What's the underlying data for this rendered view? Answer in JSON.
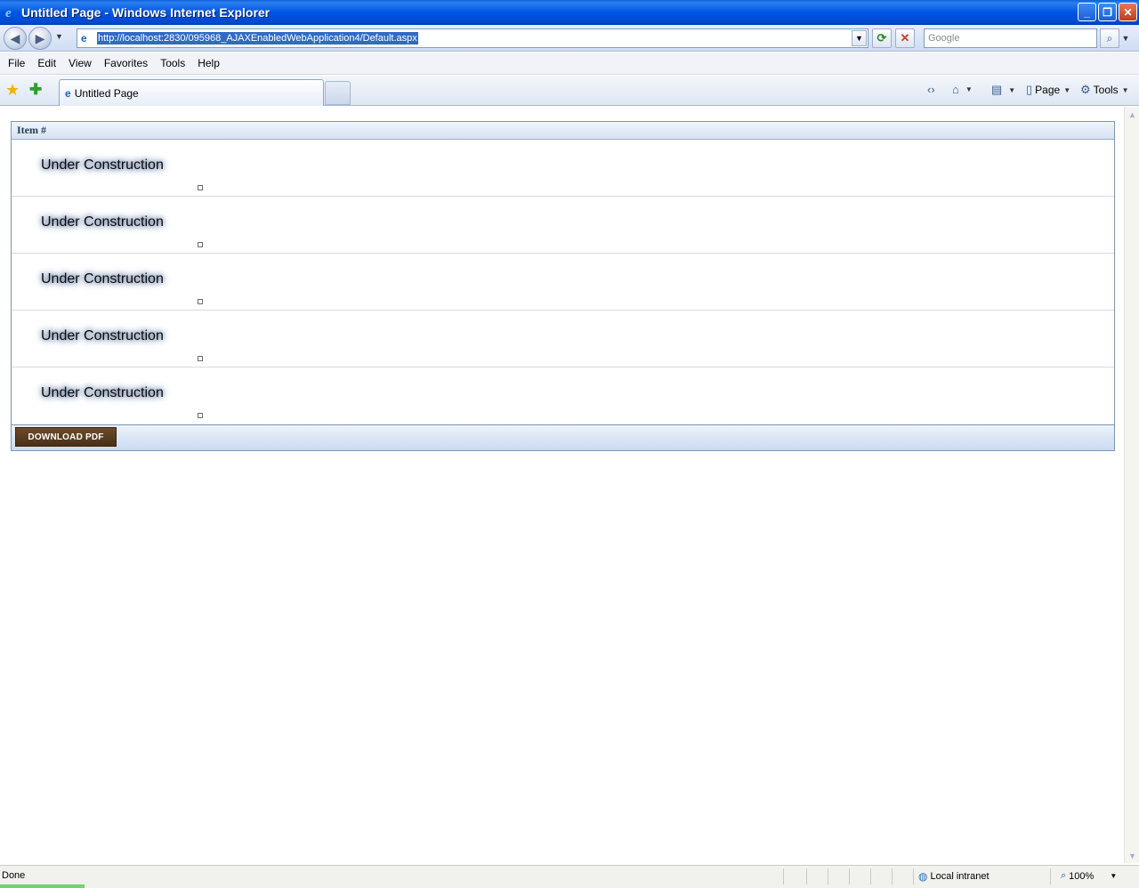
{
  "window": {
    "title": "Untitled Page - Windows Internet Explorer",
    "controls": {
      "minimize": "_",
      "restore": "❐",
      "close": "✕"
    }
  },
  "address_bar": {
    "url": "http://localhost:2830/095968_AJAXEnabledWebApplication4/Default.aspx",
    "search_placeholder": "Google"
  },
  "menu": {
    "items": [
      "File",
      "Edit",
      "View",
      "Favorites",
      "Tools",
      "Help"
    ],
    "underlined": [
      "F",
      "E",
      "V",
      "a",
      "T",
      "H"
    ]
  },
  "tabs": {
    "active_label": "Untitled Page"
  },
  "command_bar": {
    "page_label": "Page",
    "tools_label": "Tools"
  },
  "grid": {
    "header": "Item #",
    "rows": [
      {
        "label": "Under Construction"
      },
      {
        "label": "Under Construction"
      },
      {
        "label": "Under Construction"
      },
      {
        "label": "Under Construction"
      },
      {
        "label": "Under Construction"
      }
    ],
    "footer_button": "DOWNLOAD PDF"
  },
  "status_bar": {
    "status": "Done",
    "zone": "Local intranet",
    "zoom": "100%"
  },
  "colors": {
    "titlebar": "#0055e5",
    "download_button": "#5a3c1f",
    "grid_border": "#7d96b4",
    "text_glow": "#2c4a78"
  }
}
